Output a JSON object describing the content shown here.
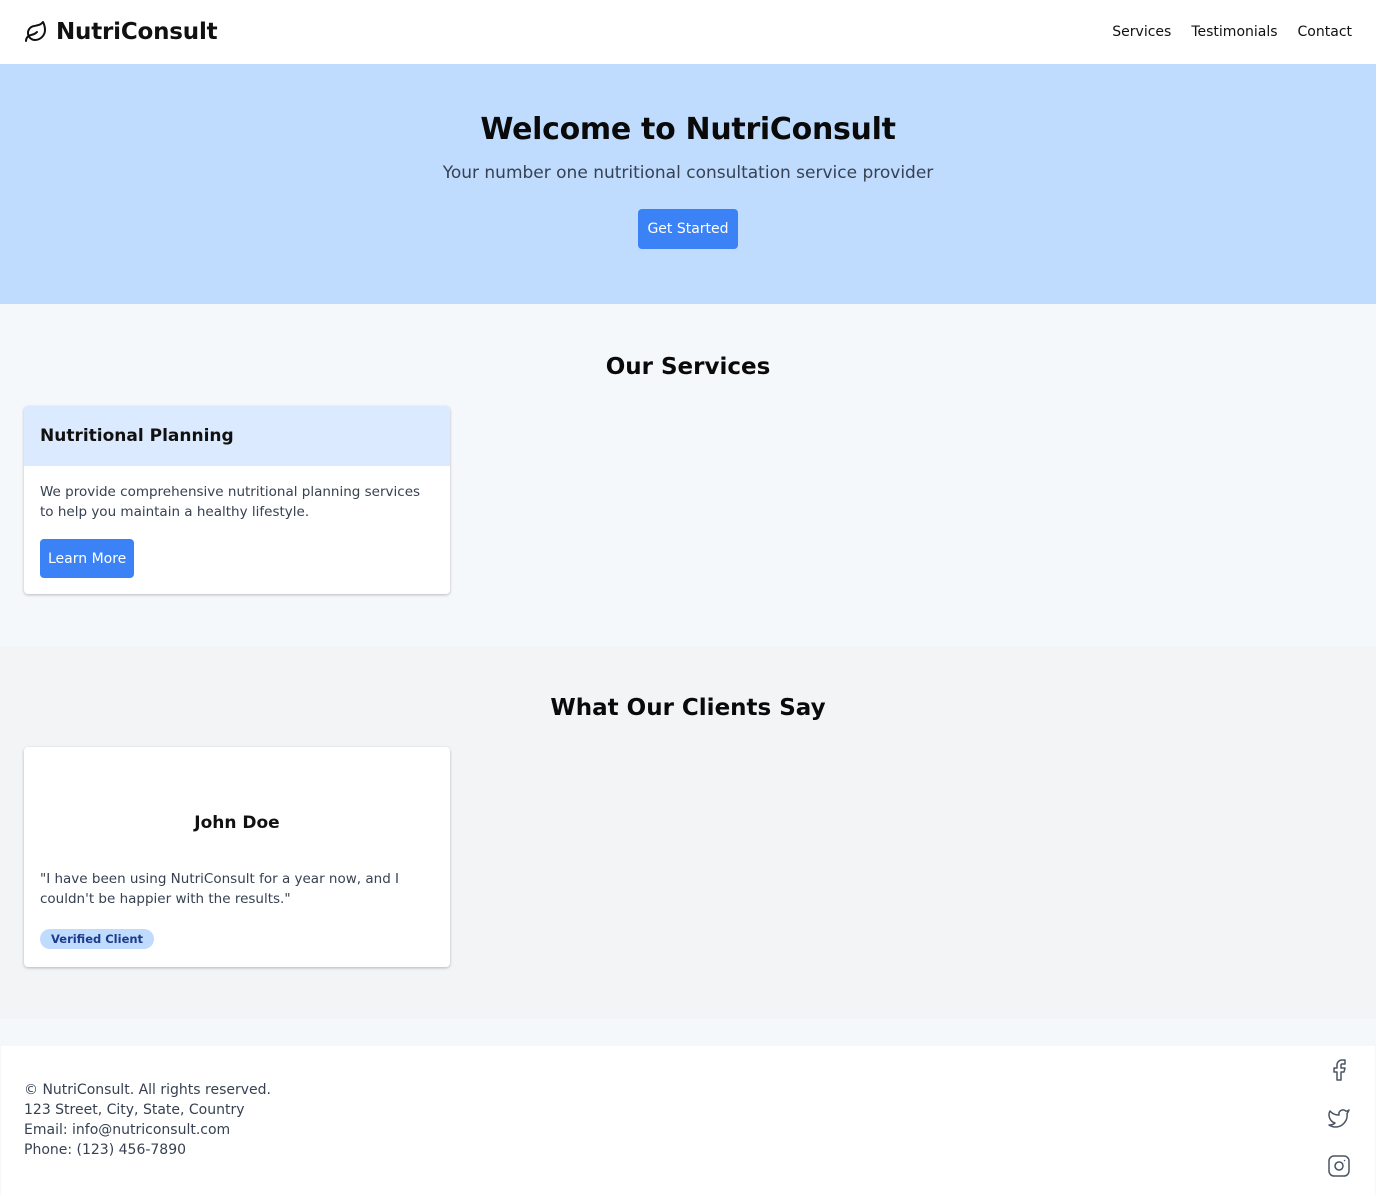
{
  "header": {
    "brand": "NutriConsult",
    "nav": [
      "Services",
      "Testimonials",
      "Contact"
    ]
  },
  "hero": {
    "title": "Welcome to NutriConsult",
    "subtitle": "Your number one nutritional consultation service provider",
    "cta": "Get Started"
  },
  "services": {
    "title": "Our Services",
    "items": [
      {
        "title": "Nutritional Planning",
        "description": "We provide comprehensive nutritional planning services to help you maintain a healthy lifestyle.",
        "button": "Learn More"
      }
    ]
  },
  "testimonials": {
    "title": "What Our Clients Say",
    "items": [
      {
        "name": "John Doe",
        "quote": "\"I have been using NutriConsult for a year now, and I couldn't be happier with the results.\"",
        "badge": "Verified Client"
      }
    ]
  },
  "footer": {
    "copyright": "© NutriConsult. All rights reserved.",
    "address": "123 Street, City, State, Country",
    "email": "Email: info@nutriconsult.com",
    "phone": "Phone: (123) 456-7890",
    "socials": [
      "facebook-icon",
      "twitter-icon",
      "instagram-icon"
    ]
  },
  "colors": {
    "accent": "#3b82f6",
    "hero_bg": "#bfdbfe",
    "card_header_bg": "#dbeafe",
    "badge_text": "#1e3a8a"
  }
}
